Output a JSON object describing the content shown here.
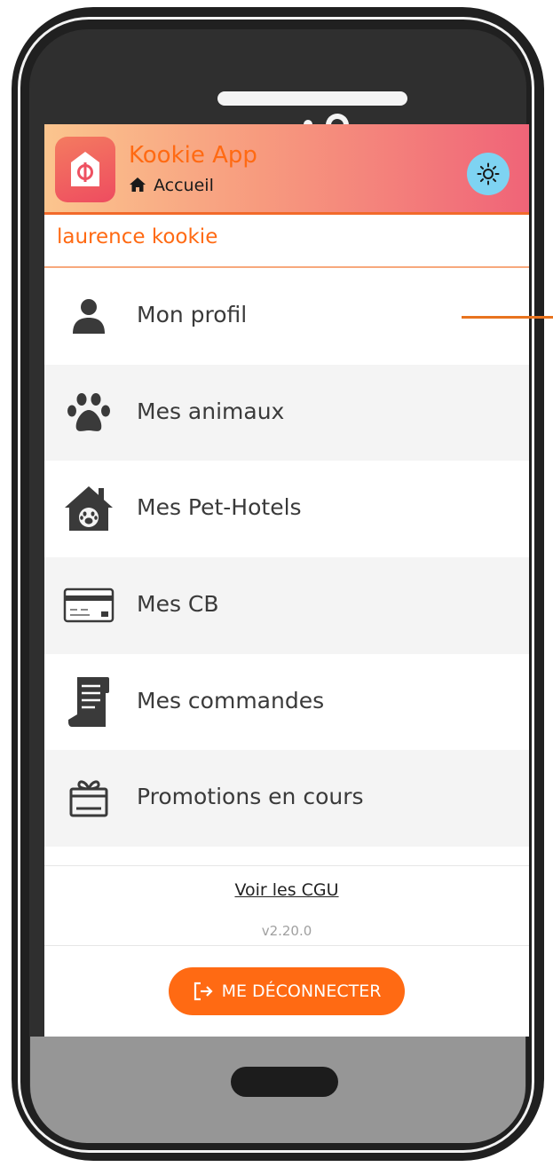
{
  "header": {
    "app_name": "Kookie App",
    "breadcrumb": "Accueil"
  },
  "user": {
    "name": "laurence kookie"
  },
  "menu": {
    "items": [
      {
        "label": "Mon profil",
        "icon": "user-icon"
      },
      {
        "label": "Mes animaux",
        "icon": "paw-icon"
      },
      {
        "label": "Mes Pet-Hotels",
        "icon": "pet-house-icon"
      },
      {
        "label": "Mes CB",
        "icon": "credit-card-icon"
      },
      {
        "label": "Mes commandes",
        "icon": "receipt-icon"
      },
      {
        "label": "Promotions en cours",
        "icon": "gift-icon"
      }
    ]
  },
  "footer": {
    "cgu_link": "Voir les CGU",
    "version": "v2.20.0",
    "logout_label": "ME DÉCONNECTER"
  },
  "colors": {
    "accent": "#ff6a13",
    "header_gradient_start": "#fbc58e",
    "header_gradient_end": "#f06478",
    "theme_toggle": "#7ed3f2"
  }
}
